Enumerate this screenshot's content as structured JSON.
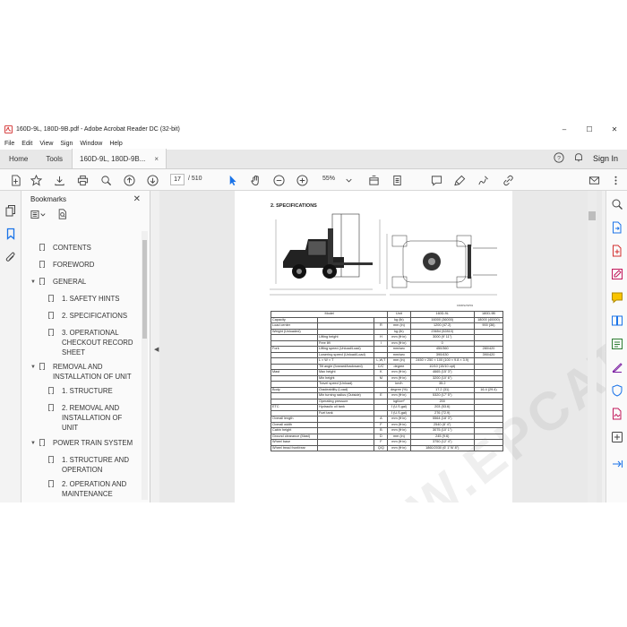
{
  "window": {
    "title": "160D-9L, 180D-9B.pdf - Adobe Acrobat Reader DC (32-bit)",
    "minimize": "–",
    "maximize": "☐",
    "close": "✕"
  },
  "menu": [
    "File",
    "Edit",
    "View",
    "Sign",
    "Window",
    "Help"
  ],
  "tabs": {
    "home": "Home",
    "tools": "Tools",
    "document": "160D-9L, 180D-9B...",
    "close": "×",
    "signin": "Sign In"
  },
  "toolbar": {
    "page_current": "17",
    "page_total": "/ 510",
    "zoom": "55%"
  },
  "bookmarks_panel": {
    "title": "Bookmarks",
    "close": "✕",
    "items": [
      {
        "label": "CONTENTS"
      },
      {
        "label": "FOREWORD"
      },
      {
        "label": "GENERAL"
      },
      {
        "label": "1. SAFETY HINTS"
      },
      {
        "label": "2. SPECIFICATIONS"
      },
      {
        "label": "3. OPERATIONAL"
      },
      {
        "label": "CHECKOUT RECORD"
      },
      {
        "label": "SHEET"
      },
      {
        "label": "REMOVAL AND"
      },
      {
        "label": "INSTALLATION OF UNIT"
      },
      {
        "label": "1. STRUCTURE"
      },
      {
        "label": "2. REMOVAL AND"
      },
      {
        "label": "INSTALLATION OF"
      },
      {
        "label": "UNIT"
      },
      {
        "label": "POWER TRAIN SYSTEM"
      },
      {
        "label": "1. STRUCTURE AND"
      },
      {
        "label": "OPERATION"
      },
      {
        "label": "2. OPERATION AND"
      },
      {
        "label": "MAINTENANCE"
      }
    ]
  },
  "document": {
    "section_title": "2. SPECIFICATIONS",
    "figure_code": "160DS2SP01",
    "watermark": "WWW.EPCATALOGS.COM",
    "table": {
      "header": [
        "Model",
        "Unit",
        "160D-9L",
        "180D-9B"
      ],
      "rows": [
        [
          "Capacity",
          "",
          "",
          "kg (lb)",
          "16000 (36000)",
          "18000 (40000)"
        ],
        [
          "Load center",
          "",
          "R",
          "mm (in)",
          "1200 (47.2)",
          "900 (36)"
        ],
        [
          "Weight (Unloaded)",
          "",
          "",
          "kg (lb)",
          "23654 (52810)",
          ""
        ],
        [
          "",
          "Lifting height",
          "H",
          "mm (ft·in)",
          "3000 (9' 11\")",
          ""
        ],
        [
          "",
          "Free lift",
          "I",
          "mm (ft·in)",
          "0",
          ""
        ],
        [
          "Fork",
          "Lifting speed (Unload/Load)",
          "",
          "mm/sec",
          "450/360",
          "280/420"
        ],
        [
          "",
          "Lowering speed (Unload/Load)",
          "",
          "mm/sec",
          "390/430",
          "390/420"
        ],
        [
          "",
          "L × W × T",
          "L,W,T",
          "mm (in)",
          "2450 × 250 × 100 (100 × 9.8 × 3.9)",
          ""
        ],
        [
          "",
          "Tilt angle (forward/backward)",
          "C/C'",
          "degree",
          "10/10 (15/10 opt)",
          ""
        ],
        [
          "Mast",
          "Max height",
          "K",
          "mm (ft·in)",
          "4665 (15' 3\")",
          ""
        ],
        [
          "",
          "Min height",
          "M",
          "mm (ft·in)",
          "3200 (10' 6\")",
          ""
        ],
        [
          "",
          "Travel speed (Unload)",
          "",
          "km/h",
          "35.2",
          ""
        ],
        [
          "Body",
          "Gradeability (Load)",
          "",
          "degree (%)",
          "17.2 (31)",
          "16.4 (29.4)"
        ],
        [
          "",
          "Min turning radius (Outside)",
          "E",
          "mm (ft·in)",
          "5320 (17' 5\")",
          ""
        ],
        [
          "",
          "Operating pressure",
          "",
          "kgf/cm²",
          "200",
          ""
        ],
        [
          "ETC",
          "Hydraulic oil tank",
          "",
          "ℓ (U.S.gal)",
          "203 (53.6)",
          ""
        ],
        [
          "",
          "Fuel tank",
          "",
          "ℓ (U.S.gal)",
          "276 (72.9)",
          ""
        ],
        [
          "Overall length",
          "",
          "A",
          "mm (ft·in)",
          "5564 (18' 3\")",
          ""
        ],
        [
          "Overall width",
          "",
          "F",
          "mm (ft·in)",
          "2540 (8' 4\")",
          ""
        ],
        [
          "Cabin height",
          "",
          "B",
          "mm (ft·in)",
          "3075 (10' 1\")",
          ""
        ],
        [
          "Ground clearance (Mast)",
          "",
          "D",
          "mm (in)",
          "245 (9.6)",
          ""
        ],
        [
          "Wheel base",
          "",
          "F",
          "mm (ft·in)",
          "3750 (12' 4\")",
          ""
        ],
        [
          "Wheel tread front/rear",
          "",
          "Q/Q",
          "mm (ft·in)",
          "1860/2030 (6' 1\"/6' 8\")",
          ""
        ]
      ]
    }
  }
}
